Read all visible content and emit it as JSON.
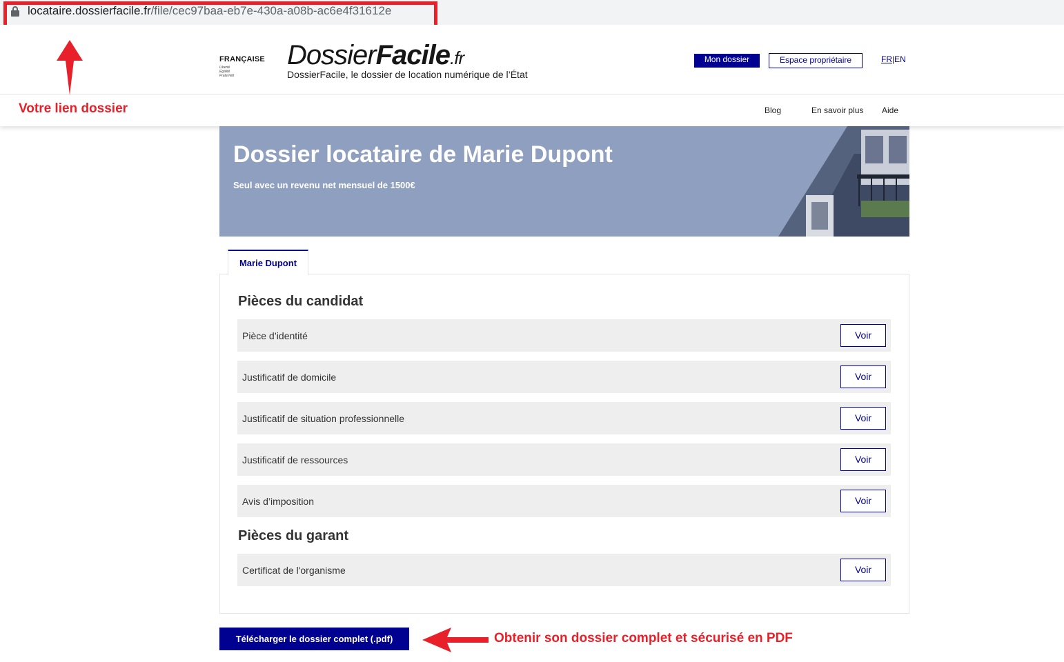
{
  "browser": {
    "url_host": "locataire.dossierfacile.fr",
    "url_path": "/file/cec97baa-eb7e-430a-a08b-ac6e4f31612e"
  },
  "header": {
    "gov_name": "FRANÇAISE",
    "gov_motto": [
      "Liberté",
      "Égalité",
      "Fraternité"
    ],
    "brand_part1": "Dossier",
    "brand_part2": "Facile",
    "brand_tld": ".fr",
    "tagline": "DossierFacile, le dossier de location numérique de l’État",
    "mon_dossier": "Mon dossier",
    "espace_proprietaire": "Espace propriétaire",
    "lang_fr": "FR",
    "lang_sep": "|",
    "lang_en": "EN",
    "nav": [
      "Blog",
      "En savoir plus",
      "Aide"
    ]
  },
  "banner": {
    "title": "Dossier locataire de Marie Dupont",
    "subtitle": "Seul avec un revenu net mensuel de 1500€"
  },
  "tab": {
    "label": "Marie Dupont"
  },
  "sections": {
    "candidat_title": "Pièces du candidat",
    "garant_title": "Pièces du garant"
  },
  "candidat_docs": [
    "Pièce d’identité",
    "Justificatif de domicile",
    "Justificatif de situation professionnelle",
    "Justificatif de ressources",
    "Avis d’imposition"
  ],
  "garant_docs": [
    "Certificat de l'organisme"
  ],
  "voir_label": "Voir",
  "download_label": "Télécharger le dossier complet (.pdf)",
  "annotations": {
    "link_note": "Votre lien dossier",
    "pdf_note": "Obtenir son dossier complet et sécurisé en PDF",
    "color": "#e8202a"
  },
  "colors": {
    "primary": "#000091",
    "banner": "#8f9fbf",
    "row_bg": "#eeeeee"
  }
}
